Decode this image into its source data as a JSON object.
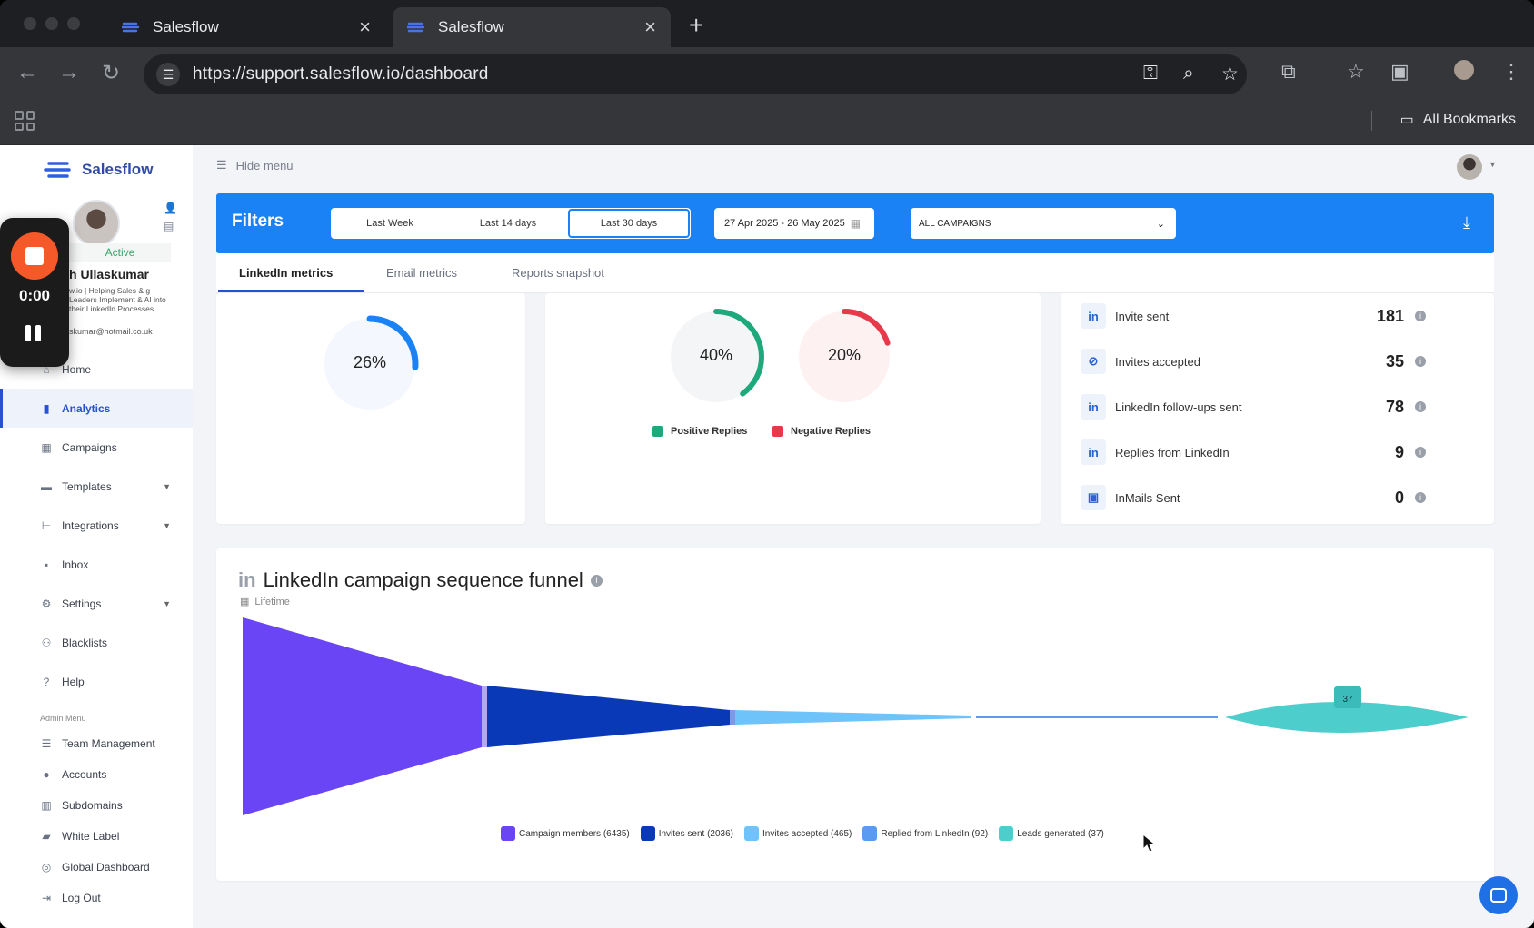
{
  "browser": {
    "tabs": [
      {
        "title": "Salesflow"
      },
      {
        "title": "Salesflow"
      }
    ],
    "url": "https://support.salesflow.io/dashboard",
    "bookmarks_label": "All Bookmarks"
  },
  "app": {
    "brand": "Salesflow",
    "hide_menu": "Hide menu",
    "profile": {
      "status": "Active",
      "name": "h Ullaskumar",
      "bio": "w.io | Helping Sales & g Leaders Implement & AI into their LinkedIn Processes",
      "email": "skumar@hotmail.co.uk"
    },
    "recorder": {
      "time": "0:00"
    },
    "menu": [
      {
        "label": "Home",
        "icon": "home-icon"
      },
      {
        "label": "Analytics",
        "icon": "analytics-icon",
        "selected": true
      },
      {
        "label": "Campaigns",
        "icon": "campaigns-icon"
      },
      {
        "label": "Templates",
        "icon": "templates-icon",
        "caret": true
      },
      {
        "label": "Integrations",
        "icon": "integrations-icon",
        "caret": true
      },
      {
        "label": "Inbox",
        "icon": "inbox-icon"
      },
      {
        "label": "Settings",
        "icon": "settings-icon",
        "caret": true
      },
      {
        "label": "Blacklists",
        "icon": "blacklists-icon"
      },
      {
        "label": "Help",
        "icon": "help-icon"
      }
    ],
    "admin_menu_label": "Admin Menu",
    "admin_menu": [
      {
        "label": "Team Management"
      },
      {
        "label": "Accounts"
      },
      {
        "label": "Subdomains"
      },
      {
        "label": "White Label"
      },
      {
        "label": "Global Dashboard"
      },
      {
        "label": "Log Out"
      }
    ],
    "filters": {
      "title": "Filters",
      "ranges": [
        "Last Week",
        "Last 14 days",
        "Last 30 days"
      ],
      "selected_range": "Last 30 days",
      "date_range": "27 Apr 2025 - 26 May 2025",
      "campaign": "ALL CAMPAIGNS"
    },
    "metric_tabs": [
      "LinkedIn metrics",
      "Email metrics",
      "Reports snapshot"
    ],
    "active_metric_tab": "LinkedIn metrics",
    "donut_left": {
      "value": "26%",
      "percent": 26,
      "color": "#1b82f5"
    },
    "donut_mid": [
      {
        "value": "40%",
        "percent": 40,
        "color": "#1ea97c"
      },
      {
        "value": "20%",
        "percent": 20,
        "color": "#e8394a"
      }
    ],
    "reply_legend": [
      {
        "label": "Positive Replies",
        "color": "#1ea97c"
      },
      {
        "label": "Negative Replies",
        "color": "#e8394a"
      }
    ],
    "stats": [
      {
        "label": "Invite sent",
        "value": "181"
      },
      {
        "label": "Invites accepted",
        "value": "35"
      },
      {
        "label": "LinkedIn follow-ups sent",
        "value": "78"
      },
      {
        "label": "Replies from LinkedIn",
        "value": "9"
      },
      {
        "label": "InMails Sent",
        "value": "0"
      }
    ],
    "funnel": {
      "prefix": "in",
      "title": "LinkedIn campaign sequence funnel",
      "subtitle": "Lifetime",
      "tooltip": "37",
      "legend": [
        {
          "label": "Campaign members (6435)",
          "color": "#6a45f5"
        },
        {
          "label": "Invites sent (2036)",
          "color": "#0a39b8"
        },
        {
          "label": "Invites accepted (465)",
          "color": "#6fc3fb"
        },
        {
          "label": "Replied from LinkedIn (92)",
          "color": "#5a9bf2"
        },
        {
          "label": "Leads generated (37)",
          "color": "#4dcdcb"
        }
      ]
    }
  }
}
